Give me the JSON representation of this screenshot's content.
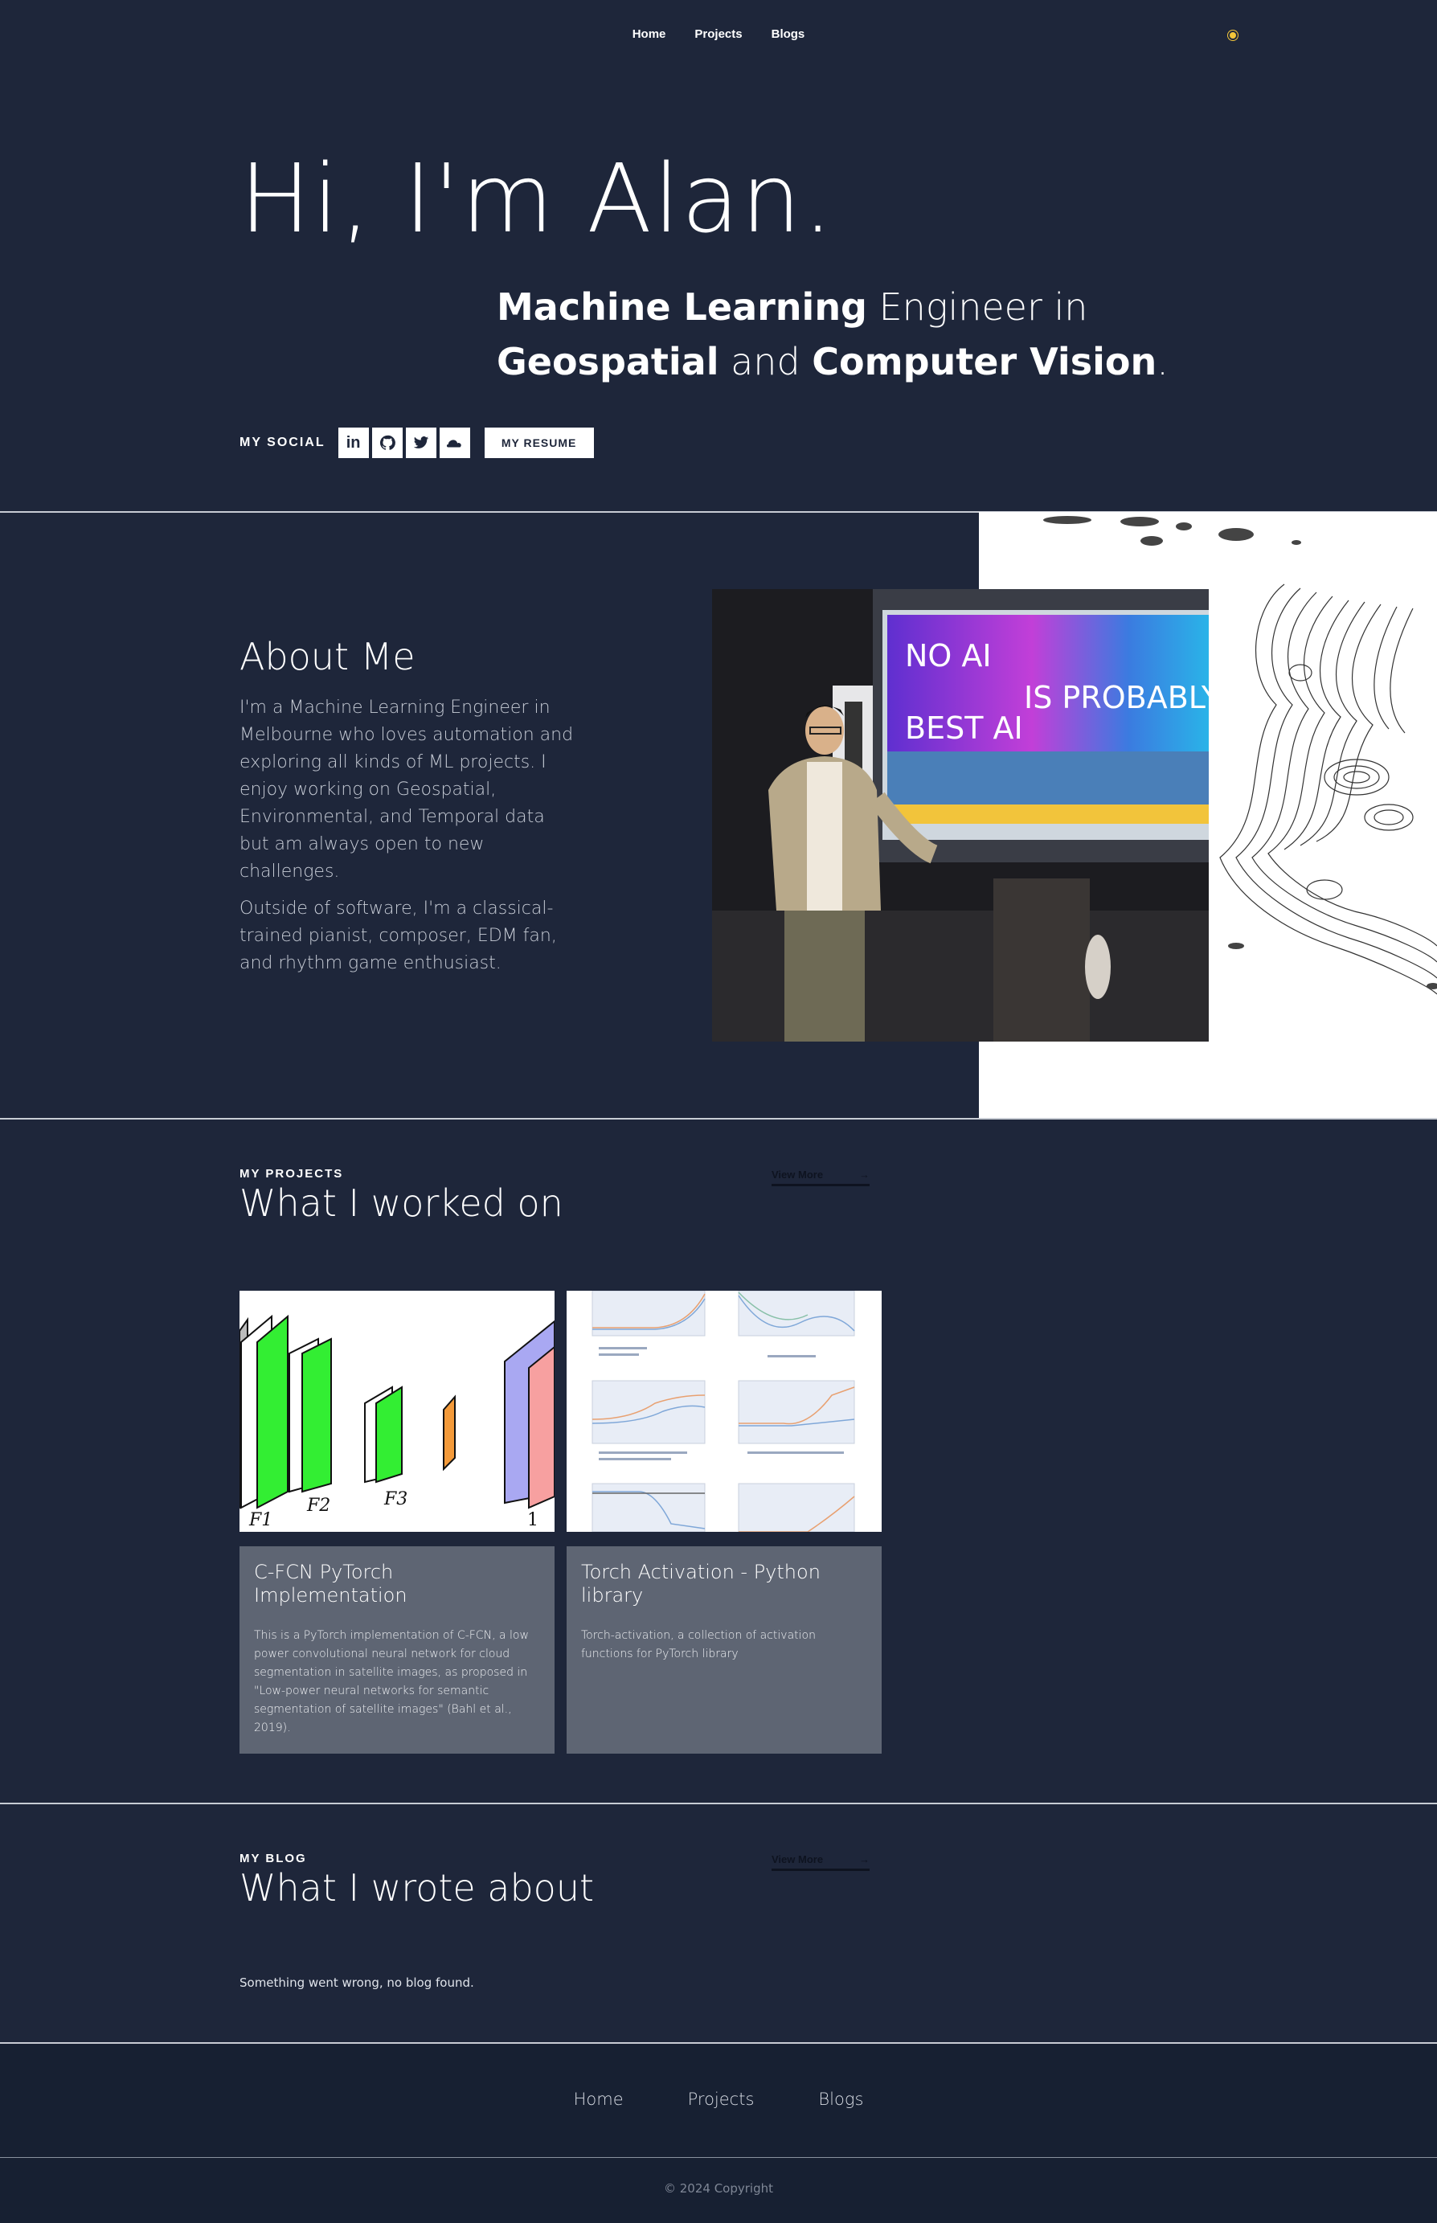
{
  "nav": {
    "links": [
      "Home",
      "Projects",
      "Blogs"
    ],
    "theme_icon": "sun-icon"
  },
  "hero": {
    "title": "Hi, I'm Alan.",
    "tagline": {
      "b1": "Machine Learning",
      "t1": " Engineer in",
      "b2": "Geospatial",
      "t2": " and ",
      "b3": "Computer Vision",
      "t3": "."
    },
    "social_label": "MY SOCIAL",
    "social_icons": [
      "linkedin-icon",
      "github-icon",
      "twitter-icon",
      "soundcloud-icon"
    ],
    "resume_label": "MY RESUME"
  },
  "about": {
    "title": "About Me",
    "paragraphs": [
      "I'm a Machine Learning Engineer in Melbourne who loves automation and exploring all kinds of ML projects. I enjoy working on Geospatial, Environmental, and Temporal data but am always open to new challenges.",
      "Outside of software, I'm a classical-trained pianist, composer, EDM fan, and rhythm game enthusiast."
    ],
    "photo_slide_text": [
      "NO AI",
      "IS PROBABLY",
      "BEST AI"
    ]
  },
  "projects": {
    "kicker": "MY PROJECTS",
    "title": "What I worked on",
    "view_more": "View More",
    "items": [
      {
        "title": "C-FCN PyTorch Implementation",
        "description": "This is a PyTorch implementation of C-FCN, a low power convolutional neural network for cloud segmentation in satellite images, as proposed in \"Low-power neural networks for semantic segmentation of satellite images\" (Bahl et al., 2019).",
        "figure_labels": [
          "F1",
          "F2",
          "F3",
          "1"
        ]
      },
      {
        "title": "Torch Activation - Python library",
        "description": "Torch-activation, a collection of activation functions for PyTorch library"
      }
    ]
  },
  "blog": {
    "kicker": "MY BLOG",
    "title": "What I wrote about",
    "view_more": "View More",
    "empty_message": "Something went wrong, no blog found."
  },
  "footer": {
    "links": [
      "Home",
      "Projects",
      "Blogs"
    ],
    "copyright": "© 2024 Copyright"
  },
  "colors": {
    "background": "#1e263a",
    "footer": "#172032",
    "card_body": "#5e6573",
    "accent_sun": "#f3c63a"
  }
}
